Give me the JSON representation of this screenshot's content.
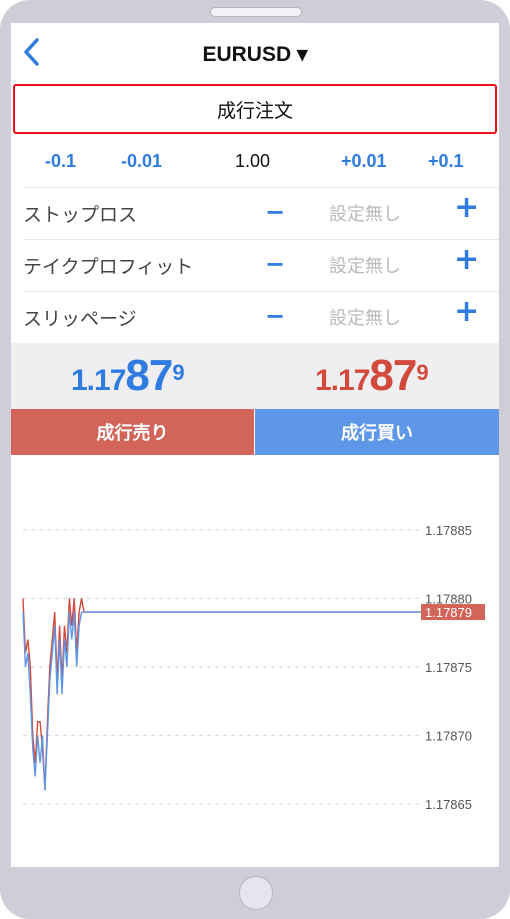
{
  "header": {
    "symbol_title": "EURUSD ▾",
    "order_type": "成行注文"
  },
  "volume": {
    "minus_big": "-0.1",
    "minus_small": "-0.01",
    "value": "1.00",
    "plus_small": "+0.01",
    "plus_big": "+0.1"
  },
  "params": [
    {
      "label": "ストップロス",
      "minus": "−",
      "value": "設定無し",
      "plus": "+"
    },
    {
      "label": "テイクプロフィット",
      "minus": "−",
      "value": "設定無し",
      "plus": "+"
    },
    {
      "label": "スリッページ",
      "minus": "−",
      "value": "設定無し",
      "plus": "+"
    }
  ],
  "quotes": {
    "bid": {
      "small": "1.17",
      "big": "87",
      "sup": "9",
      "color": "#2f7be0"
    },
    "ask": {
      "small": "1.17",
      "big": "87",
      "sup": "9",
      "color": "#d24a3c"
    }
  },
  "actions": {
    "sell_label": "成行売り",
    "buy_label": "成行買い"
  },
  "chart_data": {
    "type": "line",
    "y_ticks": [
      "1.17885",
      "1.17880",
      "1.17875",
      "1.17870",
      "1.17865"
    ],
    "ylim": [
      1.17862,
      1.17889
    ],
    "current_price_label": "1.17879",
    "current_price": 1.17879,
    "grid": true,
    "series": [
      {
        "color": "#d24a3c",
        "values": [
          1.1788,
          1.17876,
          1.17877,
          1.17875,
          1.1787,
          1.17868,
          1.17871,
          1.17871,
          1.17869,
          1.17866,
          1.17871,
          1.17875,
          1.17877,
          1.17879,
          1.17874,
          1.17878,
          1.17874,
          1.17878,
          1.17876,
          1.1788,
          1.17878,
          1.1788,
          1.17876,
          1.17879,
          1.1788,
          1.17879
        ]
      },
      {
        "color": "#5e96e8",
        "values": [
          1.17879,
          1.17875,
          1.17876,
          1.17873,
          1.17869,
          1.17867,
          1.1787,
          1.17868,
          1.1787,
          1.17866,
          1.1787,
          1.17874,
          1.17876,
          1.17878,
          1.17873,
          1.17877,
          1.17873,
          1.17877,
          1.17875,
          1.17879,
          1.17877,
          1.17879,
          1.17875,
          1.17878,
          1.17879,
          1.17879
        ]
      }
    ]
  }
}
